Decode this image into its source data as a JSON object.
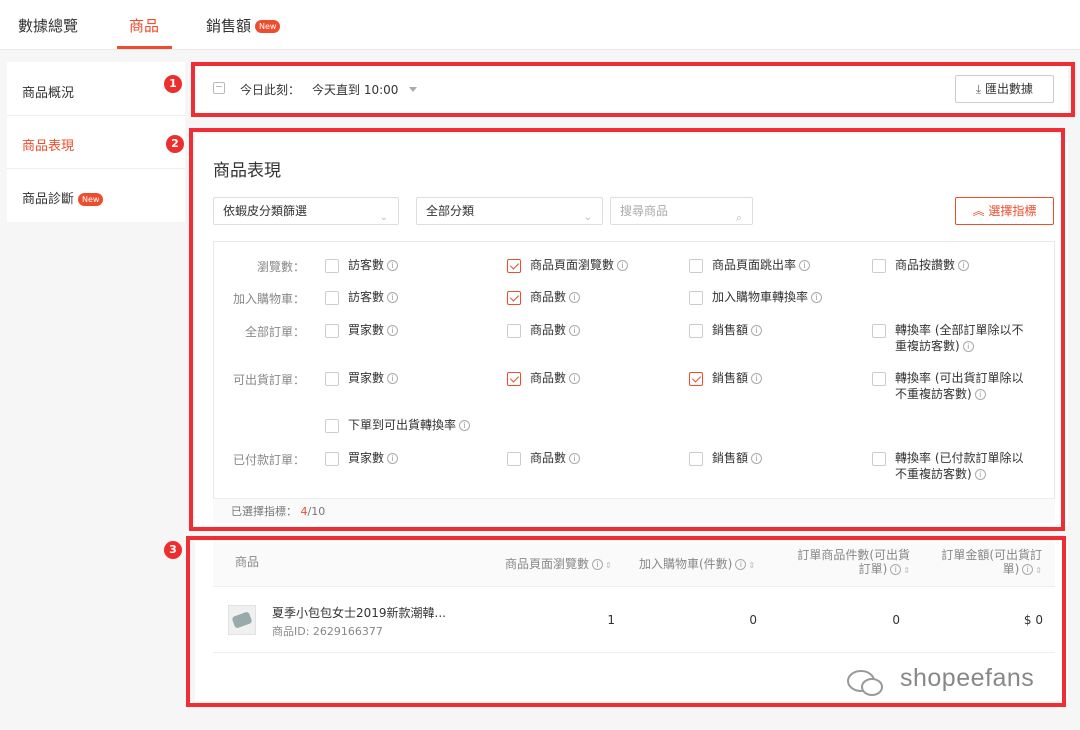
{
  "topnav": {
    "tabs": [
      {
        "label": "數據總覽"
      },
      {
        "label": "商品"
      },
      {
        "label": "銷售額",
        "badge": "New"
      }
    ]
  },
  "sidebar": {
    "items": [
      {
        "label": "商品概況"
      },
      {
        "label": "商品表現"
      },
      {
        "label": "商品診斷",
        "badge": "New"
      }
    ]
  },
  "markers": [
    "1",
    "2",
    "3"
  ],
  "datebar": {
    "label": "今日此刻：",
    "value": "今天直到 10:00",
    "export_label": "匯出數據"
  },
  "performance": {
    "title": "商品表現",
    "filter_shop_category": "依蝦皮分類篩選",
    "filter_all_category": "全部分類",
    "search_placeholder": "搜尋商品",
    "select_metrics_label": "選擇指標",
    "rows": [
      {
        "label": "瀏覽數：",
        "items": [
          {
            "text": "訪客數",
            "checked": false
          },
          {
            "text": "商品頁面瀏覽數",
            "checked": true
          },
          {
            "text": "商品頁面跳出率",
            "checked": false
          },
          {
            "text": "商品按讚數",
            "checked": false
          }
        ]
      },
      {
        "label": "加入購物車：",
        "items": [
          {
            "text": "訪客數",
            "checked": false
          },
          {
            "text": "商品數",
            "checked": true
          },
          {
            "text": "加入購物車轉換率",
            "checked": false
          }
        ]
      },
      {
        "label": "全部訂單：",
        "items": [
          {
            "text": "買家數",
            "checked": false
          },
          {
            "text": "商品數",
            "checked": false
          },
          {
            "text": "銷售額",
            "checked": false
          },
          {
            "text": "轉換率 (全部訂單除以不",
            "text2": "重複訪客數)",
            "checked": false
          }
        ]
      },
      {
        "label": "可出貨訂單：",
        "items": [
          {
            "text": "買家數",
            "checked": false
          },
          {
            "text": "商品數",
            "checked": true
          },
          {
            "text": "銷售額",
            "checked": true
          },
          {
            "text": "轉換率 (可出貨訂單除以",
            "text2": "不重複訪客數)",
            "checked": false
          },
          {
            "text": "下單到可出貨轉換率",
            "checked": false
          }
        ]
      },
      {
        "label": "已付款訂單：",
        "items": [
          {
            "text": "買家數",
            "checked": false
          },
          {
            "text": "商品數",
            "checked": false
          },
          {
            "text": "銷售額",
            "checked": false
          },
          {
            "text": "轉換率 (已付款訂單除以",
            "text2": "不重複訪客數)",
            "checked": false
          }
        ]
      }
    ],
    "selected_label": "已選擇指標：",
    "selected_count": "4",
    "selected_total": "/10"
  },
  "table": {
    "headers": {
      "product": "商品",
      "page_views": "商品頁面瀏覽數",
      "add_to_cart": "加入購物車(件數)",
      "order_items_1": "訂單商品件數(可出貨",
      "order_items_2": "訂單)",
      "order_amount_1": "訂單金額(可出貨訂",
      "order_amount_2": "單)"
    },
    "rows": [
      {
        "name": "夏季小包包女士2019新款潮韓...",
        "id": "商品ID: 2629166377",
        "page_views": "1",
        "add_to_cart": "0",
        "order_items": "0",
        "order_amount": "$ 0"
      }
    ]
  },
  "watermark": "shopeefans"
}
